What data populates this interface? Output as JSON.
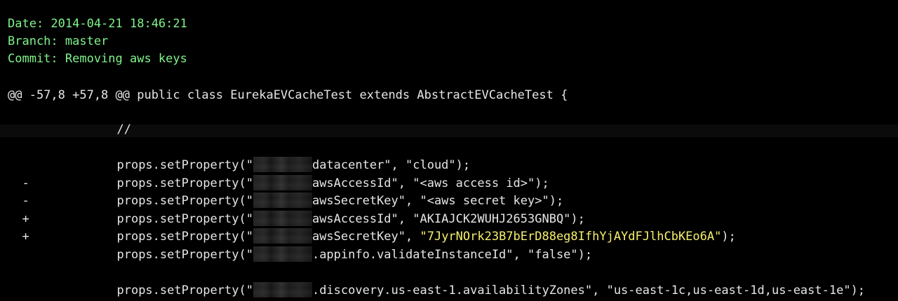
{
  "commit": {
    "date": "Date: 2014-04-21 18:46:21",
    "branch": "Branch: master",
    "message": "Commit: Removing aws keys"
  },
  "diff": {
    "hunk_header": "@@ -57,8 +57,8 @@ public class EurekaEVCacheTest extends AbstractEVCacheTest {",
    "lines": [
      {
        "prefix": "",
        "text": "//"
      },
      {
        "prefix": "",
        "before": "props.setProperty(\"",
        "after": "datacenter\", \"cloud\");"
      },
      {
        "prefix": "-",
        "before": "props.setProperty(\"",
        "after": "awsAccessId\", \"<aws access id>\");"
      },
      {
        "prefix": "-",
        "before": "props.setProperty(\"",
        "after": "awsSecretKey\", \"<aws secret key>\");"
      },
      {
        "prefix": "+",
        "before": "props.setProperty(\"",
        "after": "awsAccessId\", \"AKIAJCK2WUHJ2653GNBQ\");"
      },
      {
        "prefix": "+",
        "before": "props.setProperty(\"",
        "middle": "awsSecretKey\", ",
        "highlight": "\"7JyrNOrk23B7bErD88eg8IfhYjAYdFJlhCbKEo6A\"",
        "after": ");"
      },
      {
        "prefix": "",
        "before": "props.setProperty(\"",
        "after": ".appinfo.validateInstanceId\", \"false\");"
      },
      {
        "prefix": "",
        "before": "props.setProperty(\"",
        "after": ".discovery.us-east-1.availabilityZones\", \"us-east-1c,us-east-1d,us-east-1e\");"
      }
    ]
  },
  "colors": {
    "background": "#000000",
    "meta_text": "#7ff48a",
    "code_text": "#e6e6e6",
    "highlight_text": "#f7f06d"
  }
}
